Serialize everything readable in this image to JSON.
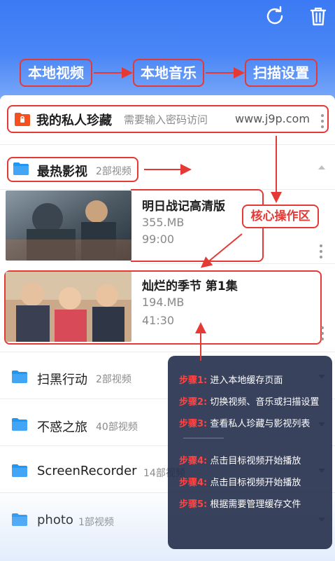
{
  "tabs": [
    "本地视频",
    "本地音乐",
    "扫描设置"
  ],
  "private": {
    "title": "我的私人珍藏",
    "hint": "需要输入密码访问",
    "url": "www.j9p.com"
  },
  "hot": {
    "title": "最热影视",
    "count": "2部视频"
  },
  "videos": [
    {
      "title": "明日战记高清版",
      "size": "355.MB",
      "duration": "99:00"
    },
    {
      "title": "灿烂的季节 第1集",
      "size": "194.MB",
      "duration": "41:30"
    }
  ],
  "core_label": "核心操作区",
  "folders": [
    {
      "title": "扫黑行动",
      "count": "2部视频"
    },
    {
      "title": "不惑之旅",
      "count": "40部视频"
    },
    {
      "title": "ScreenRecorder",
      "count": "14部视频"
    },
    {
      "title": "photo",
      "count": "1部视频"
    }
  ],
  "steps": [
    {
      "tag": "步骤1:",
      "text": "进入本地缓存页面"
    },
    {
      "tag": "步骤2:",
      "text": "切换视频、音乐或扫描设置"
    },
    {
      "tag": "步骤3:",
      "text": "查看私人珍藏与影视列表"
    },
    {
      "tag": "步骤4:",
      "text": "点击目标视频开始播放"
    },
    {
      "tag": "步骤4:",
      "text": "点击目标视频开始播放"
    },
    {
      "tag": "步骤5:",
      "text": "根据需要管理缓存文件"
    }
  ],
  "colors": {
    "header_blue": "#3b7af4",
    "annotation_red": "#e53935",
    "folder_blue": "#2196f3",
    "private_orange": "#f4511e"
  }
}
